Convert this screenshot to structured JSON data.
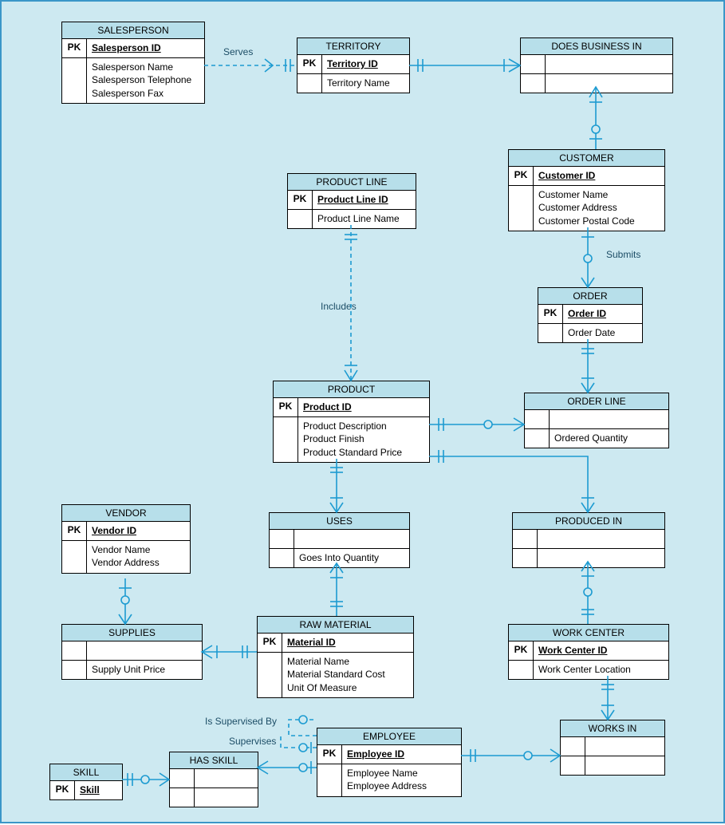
{
  "entities": {
    "salesperson": {
      "title": "SALESPERSON",
      "pk_label": "PK",
      "pk_name": "Salesperson ID",
      "attrs": [
        "Salesperson Name",
        "Salesperson Telephone",
        "Salesperson Fax"
      ]
    },
    "territory": {
      "title": "TERRITORY",
      "pk_label": "PK",
      "pk_name": "Territory ID",
      "attrs": [
        "Territory Name"
      ]
    },
    "does_business_in": {
      "title": "DOES BUSINESS IN",
      "pk_label": "",
      "pk_name": "",
      "attrs": [
        ""
      ]
    },
    "customer": {
      "title": "CUSTOMER",
      "pk_label": "PK",
      "pk_name": "Customer ID",
      "attrs": [
        "Customer Name",
        "Customer Address",
        "Customer Postal Code"
      ]
    },
    "product_line": {
      "title": "PRODUCT LINE",
      "pk_label": "PK",
      "pk_name": "Product Line ID",
      "attrs": [
        "Product Line Name"
      ]
    },
    "order": {
      "title": "ORDER",
      "pk_label": "PK",
      "pk_name": "Order ID",
      "attrs": [
        "Order Date"
      ]
    },
    "product": {
      "title": "PRODUCT",
      "pk_label": "PK",
      "pk_name": "Product ID",
      "attrs": [
        "Product Description",
        "Product Finish",
        "Product Standard Price"
      ]
    },
    "order_line": {
      "title": "ORDER LINE",
      "pk_label": "",
      "pk_name": "",
      "attrs": [
        "Ordered Quantity"
      ]
    },
    "vendor": {
      "title": "VENDOR",
      "pk_label": "PK",
      "pk_name": "Vendor ID",
      "attrs": [
        "Vendor Name",
        "Vendor Address"
      ]
    },
    "uses": {
      "title": "USES",
      "pk_label": "",
      "pk_name": "",
      "attrs": [
        "Goes Into Quantity"
      ]
    },
    "produced_in": {
      "title": "PRODUCED IN",
      "pk_label": "",
      "pk_name": "",
      "attrs": [
        ""
      ]
    },
    "supplies": {
      "title": "SUPPLIES",
      "pk_label": "",
      "pk_name": "",
      "attrs": [
        "Supply Unit Price"
      ]
    },
    "raw_material": {
      "title": "RAW MATERIAL",
      "pk_label": "PK",
      "pk_name": "Material ID",
      "attrs": [
        "Material Name",
        "Material Standard Cost",
        "Unit Of Measure"
      ]
    },
    "work_center": {
      "title": "WORK CENTER",
      "pk_label": "PK",
      "pk_name": "Work Center ID",
      "attrs": [
        "Work Center Location"
      ]
    },
    "employee": {
      "title": "EMPLOYEE",
      "pk_label": "PK",
      "pk_name": "Employee ID",
      "attrs": [
        "Employee Name",
        "Employee Address"
      ]
    },
    "works_in": {
      "title": "WORKS IN",
      "pk_label": "",
      "pk_name": "",
      "attrs": [
        ""
      ]
    },
    "has_skill": {
      "title": "HAS SKILL",
      "pk_label": "",
      "pk_name": "",
      "attrs": [
        ""
      ]
    },
    "skill": {
      "title": "SKILL",
      "pk_label": "PK",
      "pk_name": "Skill",
      "attrs": []
    }
  },
  "labels": {
    "serves": "Serves",
    "includes": "Includes",
    "submits": "Submits",
    "is_supervised_by": "Is Supervised By",
    "supervises": "Supervises"
  }
}
